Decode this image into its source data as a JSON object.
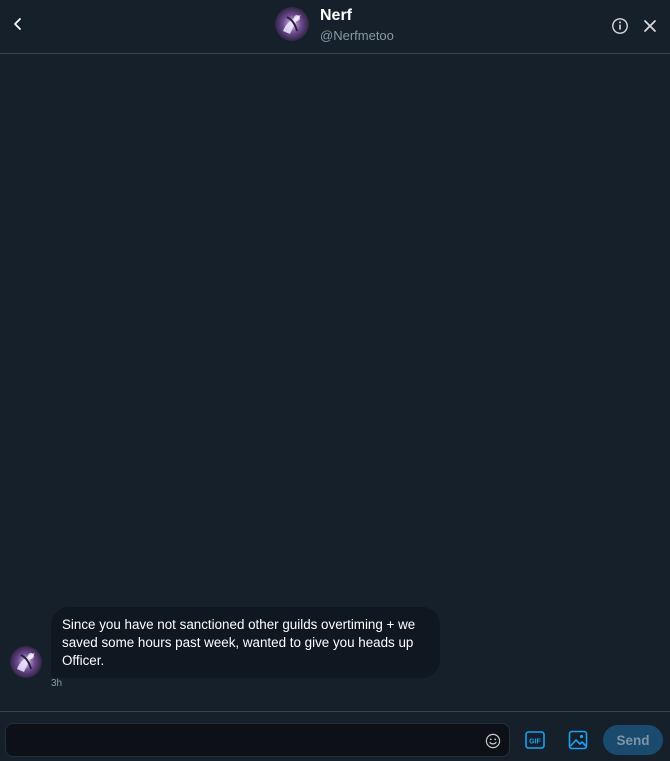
{
  "header": {
    "display_name": "Nerf",
    "handle": "@Nerfmetoo",
    "back_icon": "chevron-left-icon",
    "info_icon": "info-icon",
    "close_icon": "close-icon"
  },
  "conversation": {
    "messages": [
      {
        "text": "Since you have not sanctioned other guilds overtiming + we saved some hours past week, wanted to give you heads up Officer.",
        "time": "3h"
      }
    ]
  },
  "composer": {
    "placeholder": "",
    "value": "",
    "send_label": "Send",
    "gif_label": "GIF",
    "emoji_icon": "emoji-icon",
    "image_icon": "image-icon"
  },
  "colors": {
    "background": "#15202b",
    "bubble": "#0f1720",
    "accent": "#1da1f2",
    "send_disabled_bg": "#1a4a6e",
    "secondary_text": "#8899a6",
    "border": "#38444d"
  }
}
